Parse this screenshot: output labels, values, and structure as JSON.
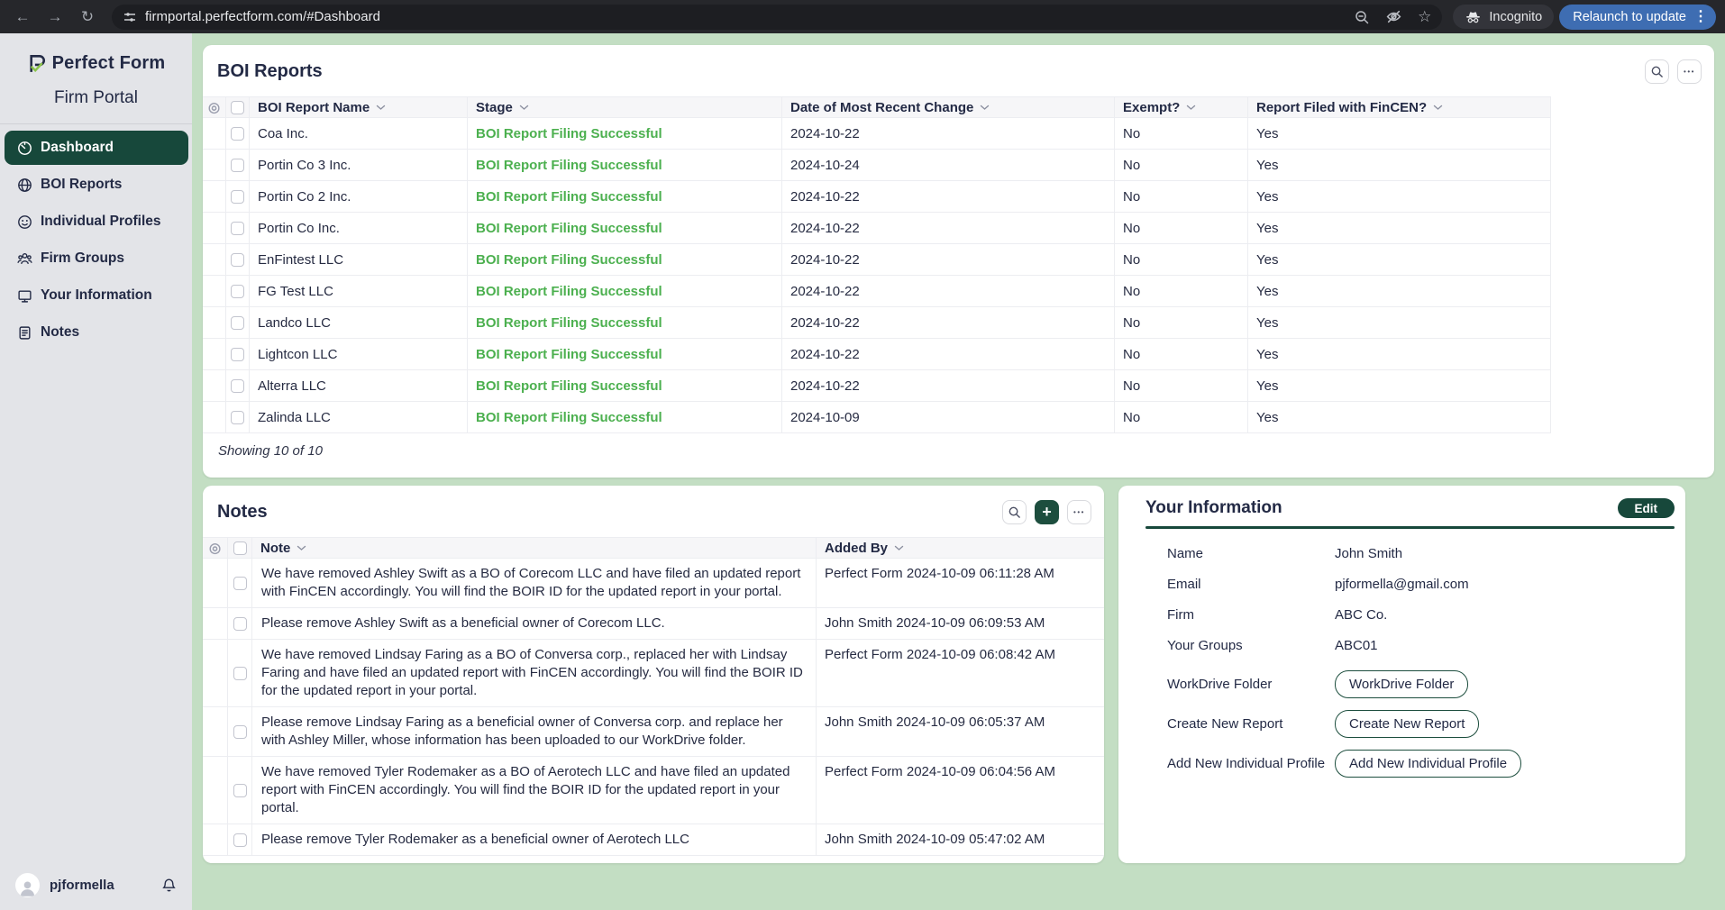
{
  "browser": {
    "url": "firmportal.perfectform.com/#Dashboard",
    "incognito_label": "Incognito",
    "relaunch_label": "Relaunch to update"
  },
  "icons": {
    "back": "←",
    "forward": "→",
    "reload": "↻",
    "star": "☆",
    "kebab": "⋮",
    "ellipsis": "•••",
    "plus": "+",
    "target": "◎"
  },
  "sidebar": {
    "brand": "Perfect Form",
    "subtitle": "Firm Portal",
    "items": [
      {
        "label": "Dashboard",
        "active": true
      },
      {
        "label": "BOI Reports",
        "active": false
      },
      {
        "label": "Individual Profiles",
        "active": false
      },
      {
        "label": "Firm Groups",
        "active": false
      },
      {
        "label": "Your Information",
        "active": false
      },
      {
        "label": "Notes",
        "active": false
      }
    ],
    "user": "pjformella"
  },
  "boi": {
    "title": "BOI Reports",
    "columns": [
      "BOI Report Name",
      "Stage",
      "Date of Most Recent Change",
      "Exempt?",
      "Report Filed with FinCEN?"
    ],
    "rows": [
      {
        "name": "Coa Inc.",
        "stage": "BOI Report Filing Successful",
        "date": "2024-10-22",
        "exempt": "No",
        "filed": "Yes"
      },
      {
        "name": "Portin Co 3 Inc.",
        "stage": "BOI Report Filing Successful",
        "date": "2024-10-24",
        "exempt": "No",
        "filed": "Yes"
      },
      {
        "name": "Portin Co 2 Inc.",
        "stage": "BOI Report Filing Successful",
        "date": "2024-10-22",
        "exempt": "No",
        "filed": "Yes"
      },
      {
        "name": "Portin Co Inc.",
        "stage": "BOI Report Filing Successful",
        "date": "2024-10-22",
        "exempt": "No",
        "filed": "Yes"
      },
      {
        "name": "EnFintest LLC",
        "stage": "BOI Report Filing Successful",
        "date": "2024-10-22",
        "exempt": "No",
        "filed": "Yes"
      },
      {
        "name": "FG Test LLC",
        "stage": "BOI Report Filing Successful",
        "date": "2024-10-22",
        "exempt": "No",
        "filed": "Yes"
      },
      {
        "name": "Landco LLC",
        "stage": "BOI Report Filing Successful",
        "date": "2024-10-22",
        "exempt": "No",
        "filed": "Yes"
      },
      {
        "name": "Lightcon LLC",
        "stage": "BOI Report Filing Successful",
        "date": "2024-10-22",
        "exempt": "No",
        "filed": "Yes"
      },
      {
        "name": "Alterra LLC",
        "stage": "BOI Report Filing Successful",
        "date": "2024-10-22",
        "exempt": "No",
        "filed": "Yes"
      },
      {
        "name": "Zalinda LLC",
        "stage": "BOI Report Filing Successful",
        "date": "2024-10-09",
        "exempt": "No",
        "filed": "Yes"
      }
    ],
    "footer": "Showing 10 of 10"
  },
  "notes": {
    "title": "Notes",
    "columns": [
      "Note",
      "Added By"
    ],
    "rows": [
      {
        "note": "We have removed Ashley Swift as a BO of Corecom LLC and have filed an updated report with FinCEN accordingly. You will find the BOIR ID for the updated report in your portal.",
        "added_by": "Perfect Form 2024-10-09 06:11:28 AM"
      },
      {
        "note": "Please remove Ashley Swift as a beneficial owner of Corecom LLC.",
        "added_by": "John Smith 2024-10-09 06:09:53 AM"
      },
      {
        "note": "We have removed Lindsay Faring as a BO of Conversa corp., replaced her with Lindsay Faring and have filed an updated report with FinCEN accordingly. You will find the BOIR ID for the updated report in your portal.",
        "added_by": "Perfect Form 2024-10-09 06:08:42 AM"
      },
      {
        "note": "Please remove Lindsay Faring as a beneficial owner of Conversa corp. and replace her with Ashley Miller, whose information has been uploaded to our WorkDrive folder.",
        "added_by": "John Smith 2024-10-09 06:05:37 AM"
      },
      {
        "note": "We have removed Tyler Rodemaker as a BO of Aerotech LLC and have filed an updated report with FinCEN accordingly. You will find the BOIR ID for the updated report in your portal.",
        "added_by": "Perfect Form 2024-10-09 06:04:56 AM"
      },
      {
        "note": "Please remove Tyler Rodemaker as a beneficial owner of Aerotech LLC",
        "added_by": "John Smith 2024-10-09 05:47:02 AM"
      }
    ]
  },
  "info": {
    "title": "Your Information",
    "edit_label": "Edit",
    "fields": [
      {
        "label": "Name",
        "value": "John Smith"
      },
      {
        "label": "Email",
        "value": "pjformella@gmail.com"
      },
      {
        "label": "Firm",
        "value": "ABC Co."
      },
      {
        "label": "Your Groups",
        "value": "ABC01"
      }
    ],
    "actions": [
      {
        "label": "WorkDrive Folder",
        "button": "WorkDrive Folder"
      },
      {
        "label": "Create New Report",
        "button": "Create New Report"
      },
      {
        "label": "Add New Individual Profile",
        "button": "Add New Individual Profile"
      }
    ]
  },
  "colors": {
    "accent_green": "#17483b",
    "status_green": "#4cb04f",
    "page_background": "#c3dec3",
    "relaunch_blue": "#3e6db2"
  }
}
